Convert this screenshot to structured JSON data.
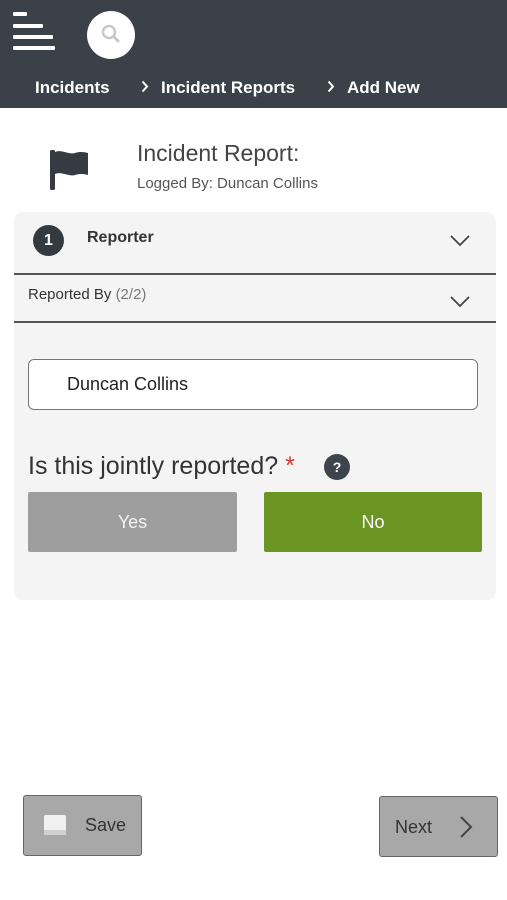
{
  "colors": {
    "topbar": "#3b4149",
    "accent_green": "#6b9522",
    "yes_gray": "#9e9e9e",
    "required_red": "#d9362b"
  },
  "icons": [
    "menu-icon",
    "search-icon",
    "chevron-right-icon",
    "flag-icon",
    "chevron-down-icon",
    "help-icon",
    "save-icon"
  ],
  "breadcrumb": [
    {
      "label": "Incidents"
    },
    {
      "label": "Incident Reports"
    },
    {
      "label": "Add New"
    }
  ],
  "header": {
    "title": "Incident Report:",
    "subtitle": "Logged By: Duncan Collins"
  },
  "step": {
    "number": "1",
    "label": "Reporter"
  },
  "section": {
    "label": "Reported By",
    "count": "(2/2)"
  },
  "reporter_field": {
    "value": "Duncan Collins"
  },
  "question": {
    "text": "Is this jointly reported?",
    "required_mark": "*",
    "help_symbol": "?",
    "options": [
      {
        "label": "Yes",
        "selected": false
      },
      {
        "label": "No",
        "selected": true
      }
    ]
  },
  "footer": {
    "save_label": "Save",
    "next_label": "Next"
  }
}
